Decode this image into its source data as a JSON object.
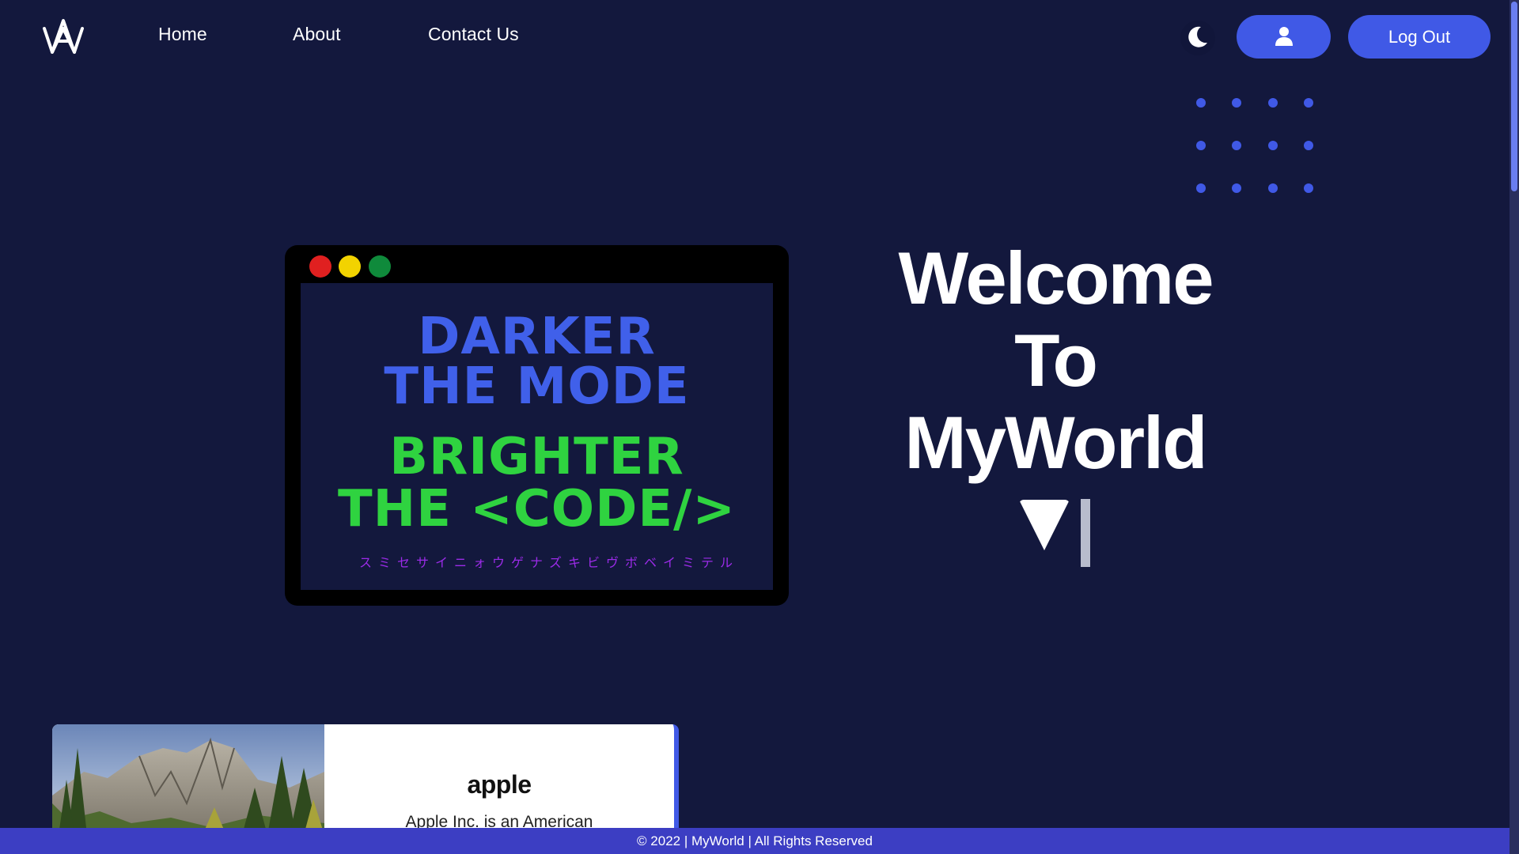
{
  "nav": {
    "logo_icon": "myworld-logo-icon",
    "links": [
      "Home",
      "About",
      "Contact Us"
    ],
    "theme_toggle_icon": "moon-icon",
    "profile_icon": "user-icon",
    "logout_label": "Log Out"
  },
  "hero": {
    "code_window": {
      "line1": "DARKER",
      "line2": "THE MODE",
      "line3": "BRIGHTER",
      "line4": "THE <CODE/>",
      "katakana": "スミセサイニォウゲナズキビヴボベイミテル"
    },
    "welcome_lines": [
      "Welcome",
      "To",
      "MyWorld"
    ]
  },
  "card": {
    "title": "apple",
    "text": "Apple Inc. is an American"
  },
  "footer": {
    "text": "© 2022 | MyWorld | All Rights Reserved"
  },
  "colors": {
    "background": "#13183d",
    "accent": "#4059e6",
    "green_code": "#2fd340",
    "footer": "#3c3ec3",
    "katakana": "#9b2be8"
  }
}
